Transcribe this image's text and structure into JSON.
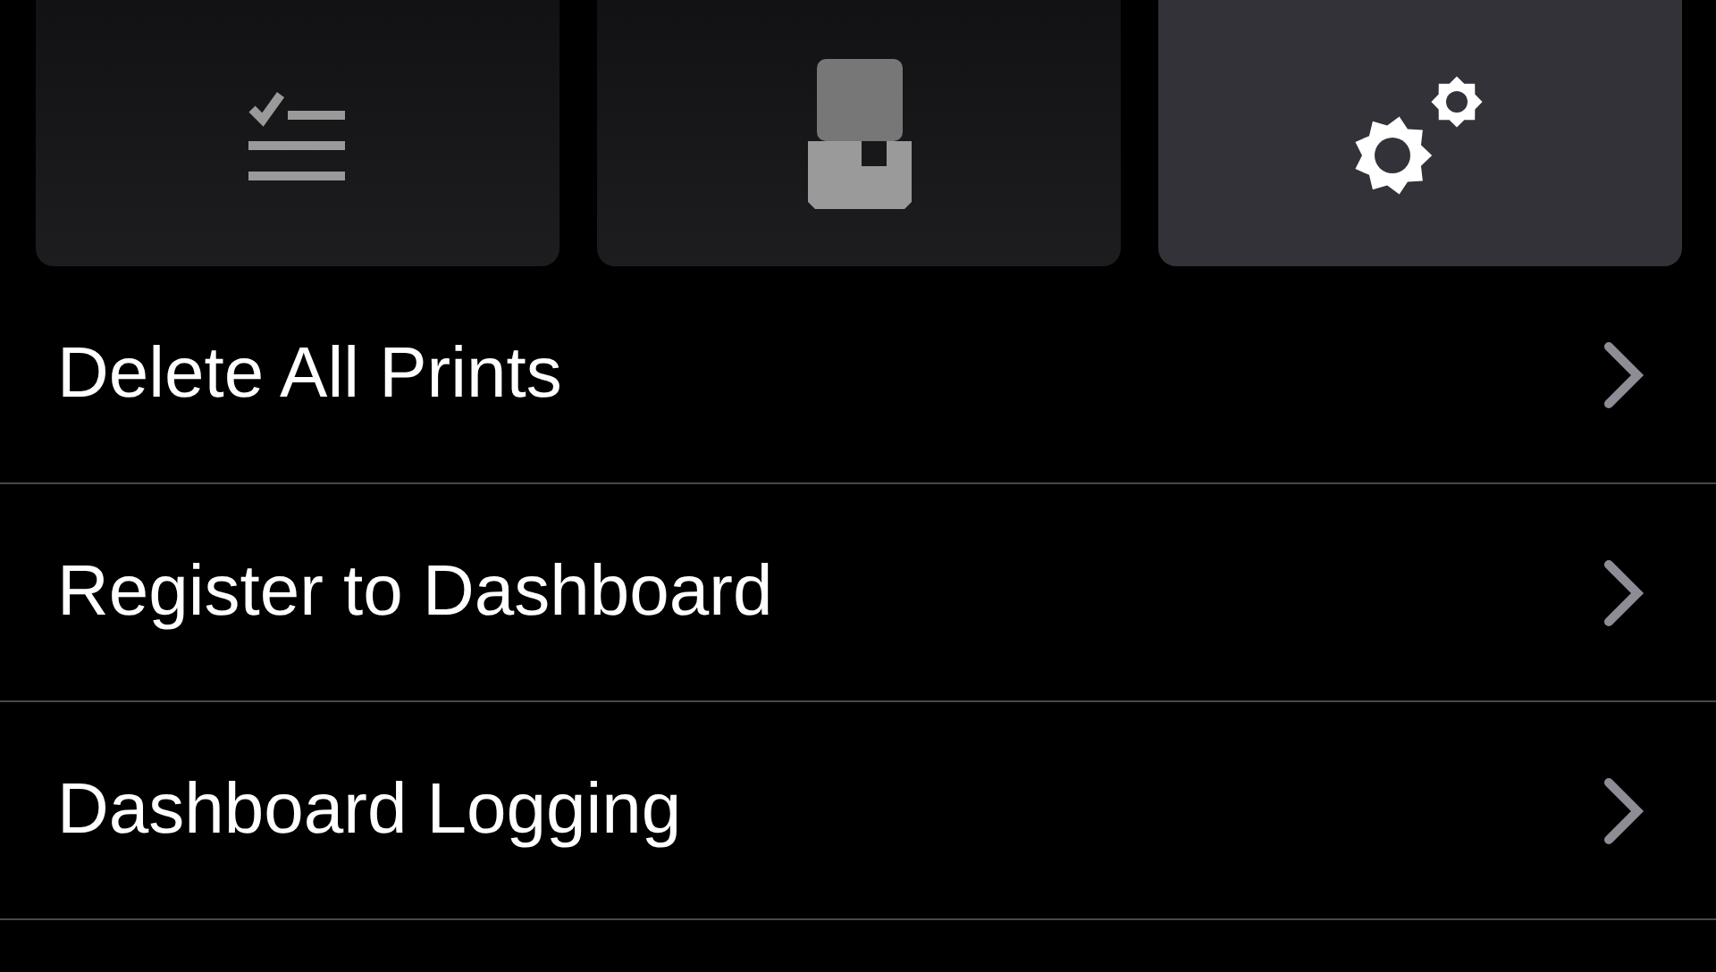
{
  "tabs": [
    {
      "kind": "checklist",
      "selected": false
    },
    {
      "kind": "printer",
      "selected": false
    },
    {
      "kind": "settings",
      "selected": true
    }
  ],
  "menu_items": [
    {
      "label": "Delete All Prints"
    },
    {
      "label": "Register to Dashboard"
    },
    {
      "label": "Dashboard Logging"
    }
  ]
}
